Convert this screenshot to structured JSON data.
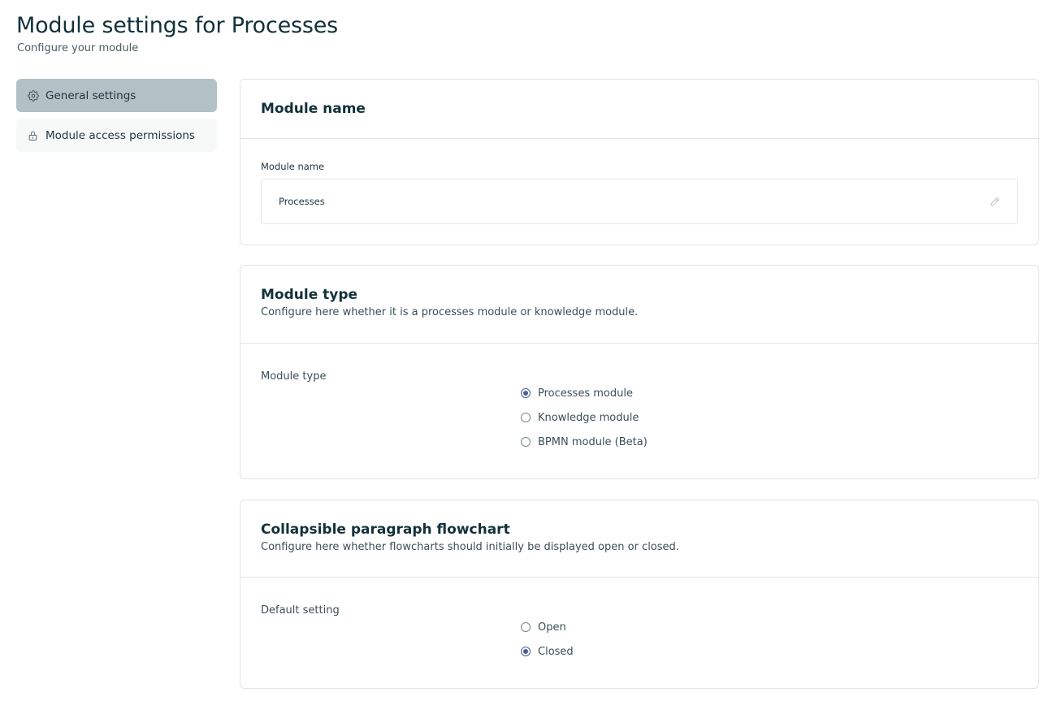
{
  "header": {
    "title": "Module settings for Processes",
    "subtitle": "Configure your module"
  },
  "sidebar": {
    "items": [
      {
        "label": "General settings",
        "icon": "gear-icon",
        "active": true
      },
      {
        "label": "Module access permissions",
        "icon": "lock-icon",
        "active": false
      }
    ]
  },
  "module_name_card": {
    "title": "Module name",
    "field_label": "Module name",
    "field_value": "Processes",
    "edit_icon": "pencil-icon"
  },
  "module_type_card": {
    "title": "Module type",
    "description": "Configure here whether it is a processes module or knowledge module.",
    "row_label": "Module type",
    "options": [
      {
        "label": "Processes module",
        "checked": true
      },
      {
        "label": "Knowledge module",
        "checked": false
      },
      {
        "label": "BPMN module (Beta)",
        "checked": false
      }
    ]
  },
  "flowchart_card": {
    "title": "Collapsible paragraph flowchart",
    "description": "Configure here whether flowcharts should initially be displayed open or closed.",
    "row_label": "Default setting",
    "options": [
      {
        "label": "Open",
        "checked": false
      },
      {
        "label": "Closed",
        "checked": true
      }
    ]
  },
  "colors": {
    "active_sidebar_bg": "#b2c1c6",
    "radio_accent": "#4a5e96",
    "title_text": "#12313a"
  }
}
